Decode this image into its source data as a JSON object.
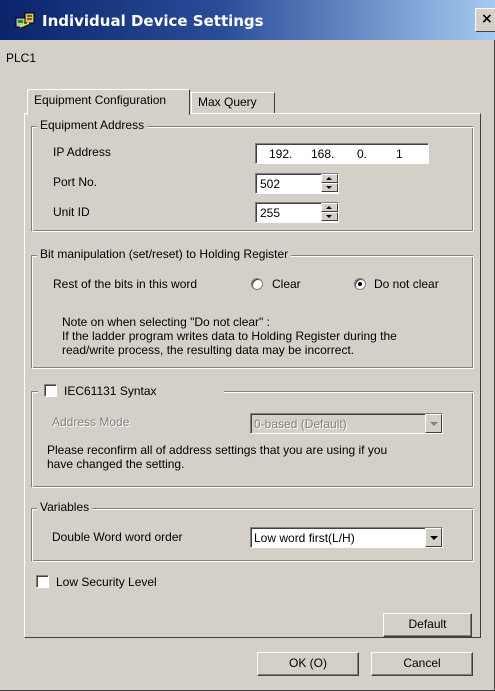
{
  "window": {
    "title": "Individual Device Settings",
    "close_label": "×",
    "device_name": "PLC1"
  },
  "tabs": [
    {
      "label": "Equipment Configuration",
      "active": true
    },
    {
      "label": "Max Query",
      "active": false
    }
  ],
  "equipment_address": {
    "legend": "Equipment Address",
    "ip_label": "IP Address",
    "ip": [
      "192.",
      "168.",
      "0.",
      "1"
    ],
    "port_label": "Port No.",
    "port_value": "502",
    "unit_label": "Unit ID",
    "unit_value": "255"
  },
  "bit_manipulation": {
    "legend": "Bit manipulation (set/reset) to Holding Register",
    "rest_label": "Rest of the bits in this word",
    "option_clear": "Clear",
    "option_do_not_clear": "Do not clear",
    "selected": "do_not_clear",
    "note": "Note on when selecting \"Do not clear\" :\nIf the ladder program writes data to Holding Register during the\nread/write process, the resulting data may be incorrect."
  },
  "iec": {
    "checkbox_label": "IEC61131 Syntax",
    "checked": false,
    "address_mode_label": "Address Mode",
    "address_mode_value": "0-based (Default)",
    "reconfirm_note": "Please reconfirm all of address settings that you are using if you\nhave changed the setting."
  },
  "variables": {
    "legend": "Variables",
    "dword_label": "Double Word word order",
    "dword_value": "Low word first(L/H)"
  },
  "low_security": {
    "label": "Low Security Level",
    "checked": false
  },
  "buttons": {
    "default_label": "Default",
    "ok_label": "OK (O)",
    "cancel_label": "Cancel"
  },
  "colors": {
    "face": "#d4d0c8",
    "title_start": "#0a246a",
    "title_end": "#a6caf0"
  }
}
